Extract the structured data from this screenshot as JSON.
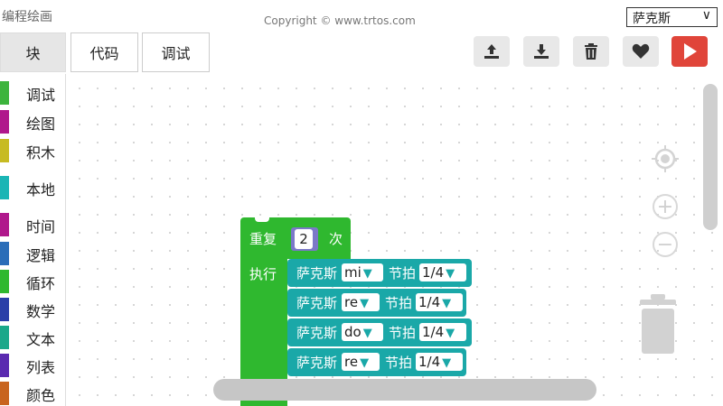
{
  "app": {
    "title": "编程绘画",
    "copyright": "Copyright © www.trtos.com"
  },
  "instrument": {
    "selected": "萨克斯",
    "chevron": "∨"
  },
  "tabs": [
    {
      "label": "块",
      "active": true
    },
    {
      "label": "代码",
      "active": false
    },
    {
      "label": "调试",
      "active": false
    }
  ],
  "toolbar": {
    "buttons": [
      {
        "name": "upload-icon"
      },
      {
        "name": "download-icon"
      },
      {
        "name": "trash-icon"
      },
      {
        "name": "heart-icon"
      },
      {
        "name": "play-icon",
        "color": "#e0453a"
      }
    ]
  },
  "categories": [
    {
      "label": "调试",
      "color": "#3cb43c"
    },
    {
      "label": "绘图",
      "color": "#b0188c"
    },
    {
      "label": "积木",
      "color": "#c7bb22"
    },
    {
      "label": "本地",
      "color": "#1ab5b5"
    },
    {
      "label": "时间",
      "color": "#b0188c"
    },
    {
      "label": "逻辑",
      "color": "#2a6db8"
    },
    {
      "label": "循环",
      "color": "#2fb82f"
    },
    {
      "label": "数学",
      "color": "#2a3fa8"
    },
    {
      "label": "文本",
      "color": "#1aa88a"
    },
    {
      "label": "列表",
      "color": "#5a2ab0"
    },
    {
      "label": "颜色",
      "color": "#c8641e"
    }
  ],
  "blocks": {
    "repeat": {
      "label": "重复",
      "count": "2",
      "suffix": "次",
      "do_label": "执行"
    },
    "notes": [
      {
        "instrument": "萨克斯",
        "pitch": "mi",
        "beat_label": "节拍",
        "beat": "1/4"
      },
      {
        "instrument": "萨克斯",
        "pitch": "re",
        "beat_label": "节拍",
        "beat": "1/4"
      },
      {
        "instrument": "萨克斯",
        "pitch": "do",
        "beat_label": "节拍",
        "beat": "1/4"
      },
      {
        "instrument": "萨克斯",
        "pitch": "re",
        "beat_label": "节拍",
        "beat": "1/4"
      }
    ],
    "dropdown_glyph": "▼"
  },
  "zoom": {
    "plus": "+",
    "minus": "−"
  }
}
